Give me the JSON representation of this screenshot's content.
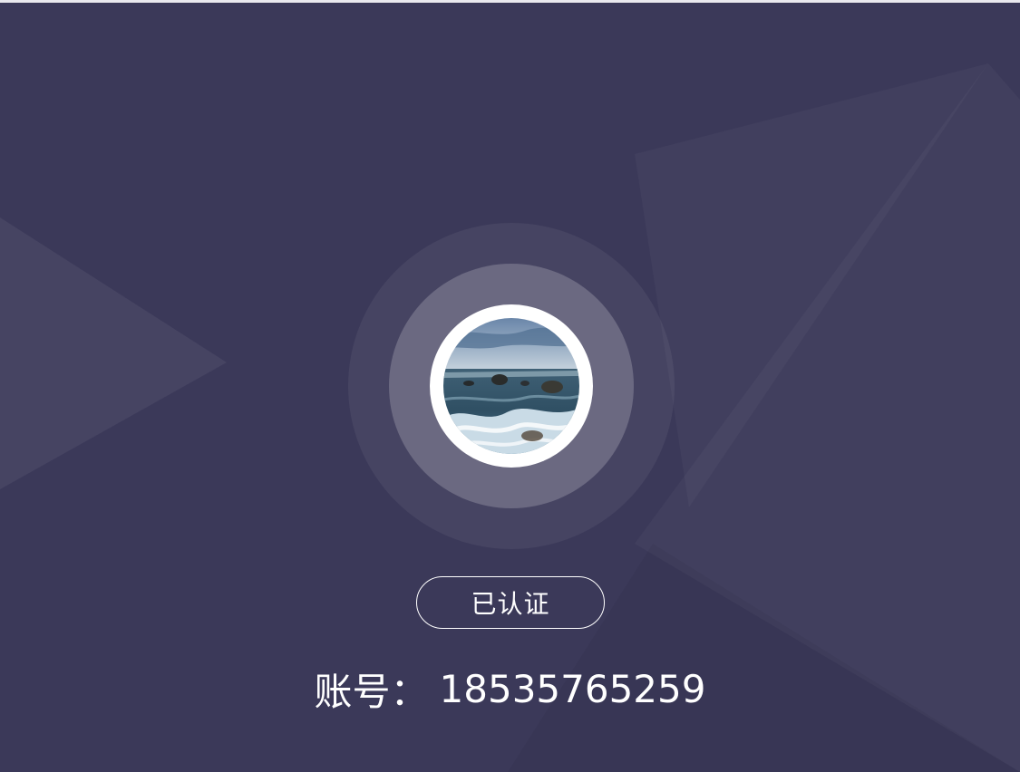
{
  "profile": {
    "avatar_icon": "avatar-seascape-photo",
    "verified_label": "已认证",
    "account_label": "账号：",
    "account_number": "18535765259"
  },
  "colors": {
    "background": "#3b3959",
    "ring": "#ffffff",
    "text": "#ffffff"
  }
}
